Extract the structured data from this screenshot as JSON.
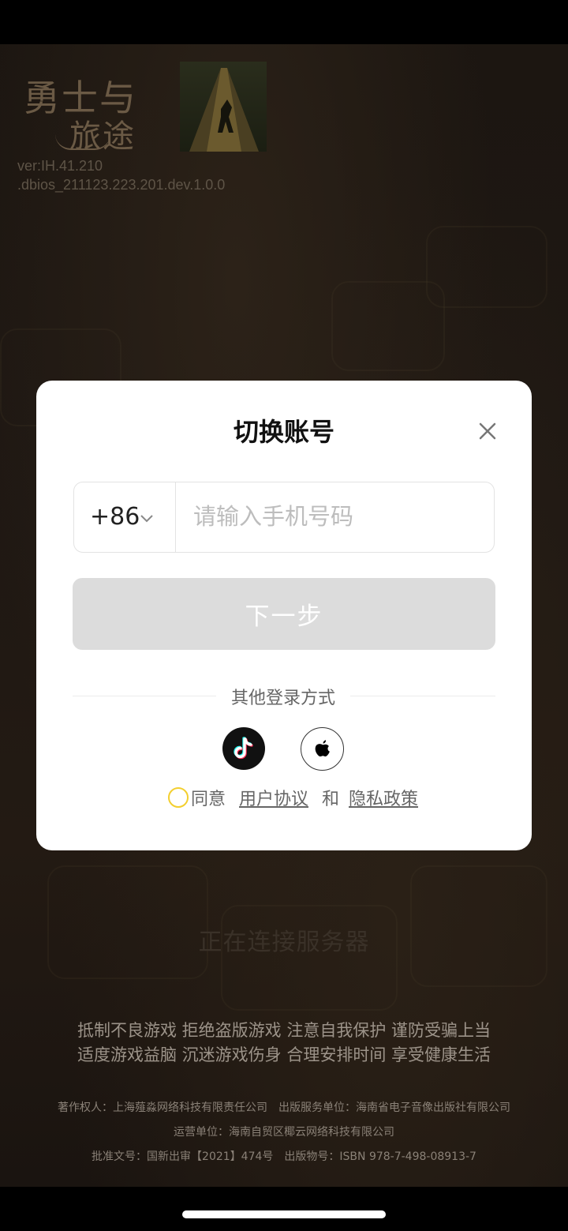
{
  "game": {
    "logo_line1": "勇士与",
    "logo_line2": "旅途",
    "version_line1": "ver:IH.41.210",
    "version_line2": ".dbios_211123.223.201.dev.1.0.0"
  },
  "login_modal": {
    "title": "切换账号",
    "country_code": "+86",
    "phone_placeholder": "请输入手机号码",
    "phone_value": "",
    "next_label": "下一步",
    "other_methods_label": "其他登录方式",
    "agree_label": "同意",
    "user_agreement_label": "用户协议",
    "and_label": "和",
    "privacy_policy_label": "隐私政策"
  },
  "icons": {
    "close": "close-icon",
    "chevron": "chevron-down-icon",
    "tiktok": "tiktok-icon",
    "apple": "apple-icon"
  },
  "colors": {
    "accent_radio": "#f3cf2f",
    "button_disabled": "#dcdcdc"
  },
  "background": {
    "connecting_text": "正在连接服务器",
    "notice_line1": "抵制不良游戏 拒绝盗版游戏 注意自我保护 谨防受骗上当",
    "notice_line2": "适度游戏益脑 沉迷游戏伤身 合理安排时间 享受健康生活",
    "copyright_line1": "著作权人：上海薤淼网络科技有限责任公司　出版服务单位：海南省电子音像出版社有限公司",
    "copyright_line2": "运营单位：海南自贸区椰云网络科技有限公司",
    "copyright_line3": "批准文号：国新出审【2021】474号　出版物号：ISBN 978-7-498-08913-7"
  }
}
